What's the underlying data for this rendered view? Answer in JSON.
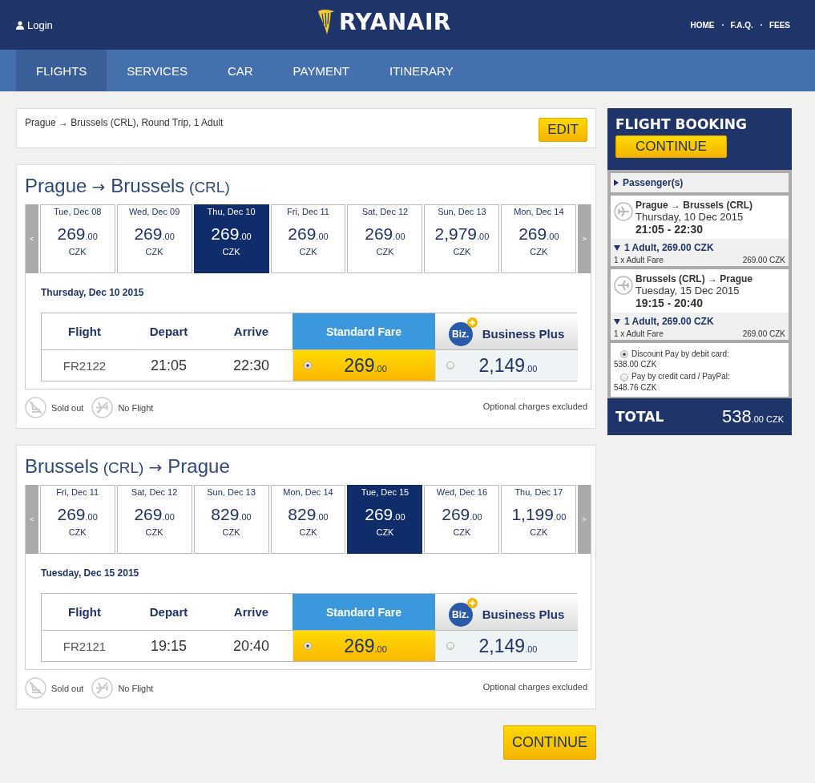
{
  "header": {
    "login": "Login",
    "logo": "RYANAIR",
    "links": [
      "HOME",
      "F.A.Q.",
      "FEES"
    ]
  },
  "nav": [
    {
      "label": "FLIGHTS",
      "selected": true
    },
    {
      "label": "SERVICES",
      "selected": false
    },
    {
      "label": "CAR",
      "selected": false
    },
    {
      "label": "PAYMENT",
      "selected": false
    },
    {
      "label": "ITINERARY",
      "selected": false
    }
  ],
  "search_summary": {
    "text": "Prague → Brussels (CRL), Round Trip, 1 Adult",
    "edit": "EDIT"
  },
  "journeys": [
    {
      "title": [
        {
          "kind": "city",
          "text": "Prague"
        },
        {
          "kind": "arrow",
          "text": "→"
        },
        {
          "kind": "city",
          "text": "Brussels"
        },
        {
          "kind": "code",
          "text": "(CRL)"
        }
      ],
      "prev": "<",
      "next": ">",
      "days": [
        {
          "label": "Tue, Dec 08",
          "price": "269",
          "decimals": ".00",
          "currency": "CZK",
          "selected": false
        },
        {
          "label": "Wed, Dec 09",
          "price": "269",
          "decimals": ".00",
          "currency": "CZK",
          "selected": false
        },
        {
          "label": "Thu, Dec 10",
          "price": "269",
          "decimals": ".00",
          "currency": "CZK",
          "selected": true
        },
        {
          "label": "Fri, Dec 11",
          "price": "269",
          "decimals": ".00",
          "currency": "CZK",
          "selected": false
        },
        {
          "label": "Sat, Dec 12",
          "price": "269",
          "decimals": ".00",
          "currency": "CZK",
          "selected": false
        },
        {
          "label": "Sun, Dec 13",
          "price": "2,979",
          "decimals": ".00",
          "currency": "CZK",
          "selected": false
        },
        {
          "label": "Mon, Dec 14",
          "price": "269",
          "decimals": ".00",
          "currency": "CZK",
          "selected": false
        }
      ],
      "date": "Thursday, Dec 10 2015",
      "columns": [
        "Flight",
        "Depart",
        "Arrive",
        "Standard Fare",
        "Business Plus"
      ],
      "biz_logo": "Biz.",
      "flights": [
        {
          "flight": "FR2122",
          "depart": "21:05",
          "arrive": "22:30",
          "fares": [
            {
              "kind": "standard",
              "price": "269",
              "decimals": ".00",
              "selected": true
            },
            {
              "kind": "business",
              "price": "2,149",
              "decimals": ".00",
              "selected": false
            }
          ]
        }
      ],
      "legend": [
        "Sold out",
        "No Flight"
      ],
      "note": "Optional charges excluded"
    },
    {
      "title": [
        {
          "kind": "city",
          "text": "Brussels"
        },
        {
          "kind": "code",
          "text": "(CRL)"
        },
        {
          "kind": "arrow",
          "text": "→"
        },
        {
          "kind": "city",
          "text": "Prague"
        }
      ],
      "prev": "<",
      "next": ">",
      "days": [
        {
          "label": "Fri, Dec 11",
          "price": "269",
          "decimals": ".00",
          "currency": "CZK",
          "selected": false
        },
        {
          "label": "Sat, Dec 12",
          "price": "269",
          "decimals": ".00",
          "currency": "CZK",
          "selected": false
        },
        {
          "label": "Sun, Dec 13",
          "price": "829",
          "decimals": ".00",
          "currency": "CZK",
          "selected": false
        },
        {
          "label": "Mon, Dec 14",
          "price": "829",
          "decimals": ".00",
          "currency": "CZK",
          "selected": false
        },
        {
          "label": "Tue, Dec 15",
          "price": "269",
          "decimals": ".00",
          "currency": "CZK",
          "selected": true
        },
        {
          "label": "Wed, Dec 16",
          "price": "269",
          "decimals": ".00",
          "currency": "CZK",
          "selected": false
        },
        {
          "label": "Thu, Dec 17",
          "price": "1,199",
          "decimals": ".00",
          "currency": "CZK",
          "selected": false
        }
      ],
      "date": "Tuesday, Dec 15 2015",
      "columns": [
        "Flight",
        "Depart",
        "Arrive",
        "Standard Fare",
        "Business Plus"
      ],
      "biz_logo": "Biz.",
      "flights": [
        {
          "flight": "FR2121",
          "depart": "19:15",
          "arrive": "20:40",
          "fares": [
            {
              "kind": "standard",
              "price": "269",
              "decimals": ".00",
              "selected": true
            },
            {
              "kind": "business",
              "price": "2,149",
              "decimals": ".00",
              "selected": false
            }
          ]
        }
      ],
      "legend": [
        "Sold out",
        "No Flight"
      ],
      "note": "Optional charges excluded"
    }
  ],
  "continue": "CONTINUE",
  "booking": {
    "title": "FLIGHT BOOKING",
    "continue": "CONTINUE",
    "passengers": {
      "label": "Passenger(s)",
      "expanded": false
    },
    "segments": [
      {
        "kind": "outbound",
        "route": "Prague → Brussels (CRL)",
        "date": "Thursday, 10 Dec 2015",
        "times": "21:05 - 22:30",
        "summary": "1 Adult, 269.00 CZK",
        "expanded": true,
        "fare_label": "1 x Adult Fare",
        "fare_amount": "269.00 CZK"
      },
      {
        "kind": "inbound",
        "route": "Brussels (CRL) → Prague",
        "date": "Tuesday, 15 Dec 2015",
        "times": "19:15 - 20:40",
        "summary": "1 Adult, 269.00 CZK",
        "expanded": true,
        "fare_label": "1 x Adult Fare",
        "fare_amount": "269.00 CZK"
      }
    ],
    "payments": [
      {
        "label": "Discount Pay by debit card:",
        "amount": "538.00 CZK",
        "selected": true
      },
      {
        "label": "Pay by credit card / PayPal:",
        "amount": "548.76 CZK",
        "selected": false
      }
    ],
    "total": {
      "label": "TOTAL",
      "amount": "538",
      "decimals": ".00",
      "currency": "CZK"
    }
  }
}
